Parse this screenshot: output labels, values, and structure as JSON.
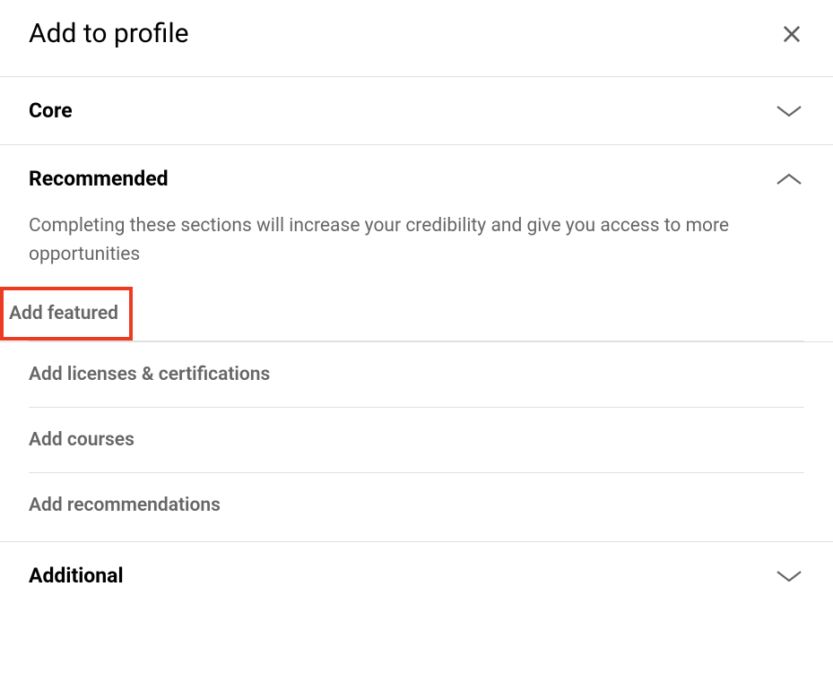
{
  "header": {
    "title": "Add to profile"
  },
  "sections": {
    "core": {
      "title": "Core"
    },
    "recommended": {
      "title": "Recommended",
      "description": "Completing these sections will increase your credibility and give you access to more opportunities",
      "items": [
        "Add featured",
        "Add licenses & certifications",
        "Add courses",
        "Add recommendations"
      ]
    },
    "additional": {
      "title": "Additional"
    }
  }
}
